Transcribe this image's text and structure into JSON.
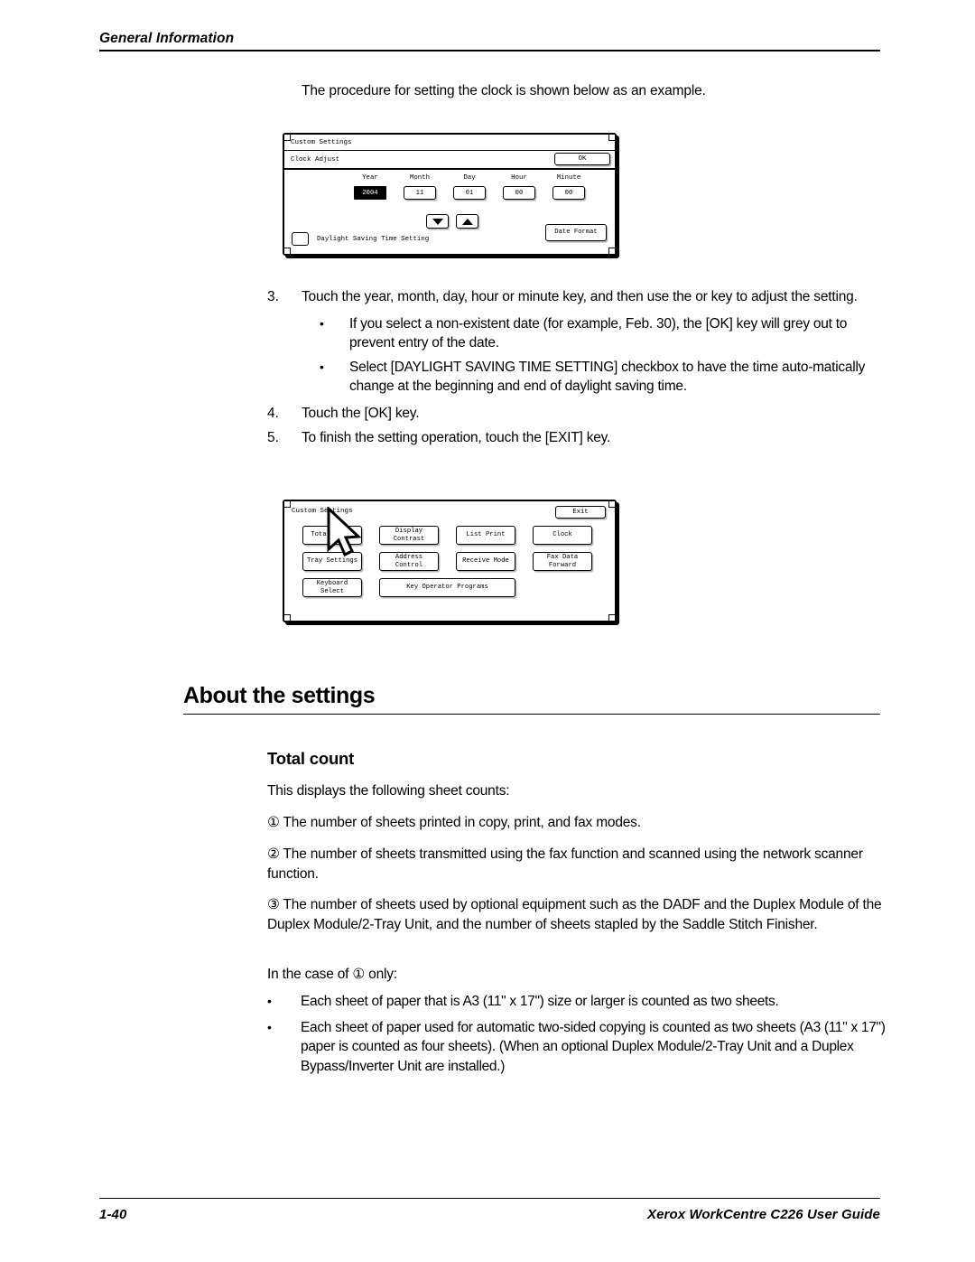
{
  "header": {
    "running_head": "General Information"
  },
  "intro": {
    "text": "The procedure for setting the clock is shown below as an example."
  },
  "clock_panel": {
    "title": "Custom Settings",
    "subtitle": "Clock Adjust",
    "ok_label": "OK",
    "fields": [
      {
        "label": "Year",
        "value": "2004",
        "selected": true
      },
      {
        "label": "Month",
        "value": "11",
        "selected": false
      },
      {
        "label": "Day",
        "value": "01",
        "selected": false
      },
      {
        "label": "Hour",
        "value": "00",
        "selected": false
      },
      {
        "label": "Minute",
        "value": "00",
        "selected": false
      }
    ],
    "down_arrow_icon": "triangle-down-icon",
    "up_arrow_icon": "triangle-up-icon",
    "checkbox_label": "Daylight Saving Time Setting",
    "checkbox_checked": false,
    "date_format_label": "Date Format"
  },
  "steps": [
    {
      "num": "3.",
      "text": "Touch the year, month, day, hour or minute key, and then use the  or  key to adjust the setting."
    },
    {
      "num": "4.",
      "text": "Touch the [OK] key."
    },
    {
      "num": "5.",
      "text": "To finish the setting operation, touch the [EXIT] key."
    }
  ],
  "step_sub_bullets": [
    {
      "bullet": "•",
      "text": "If you select a non-existent date (for example, Feb. 30), the [OK] key will grey out to prevent entry of the date."
    },
    {
      "bullet": "•",
      "text": "Select [DAYLIGHT SAVING TIME SETTING] checkbox to have the time auto-matically change at the beginning and end of daylight saving time."
    }
  ],
  "menu_panel": {
    "title": "Custom Settings",
    "exit_label": "Exit",
    "cursor_icon": "mouse-pointer-icon",
    "rows": [
      [
        {
          "label": "Total Count"
        },
        {
          "label": "Display\nContrast"
        },
        {
          "label": "List Print"
        },
        {
          "label": "Clock"
        }
      ],
      [
        {
          "label": "Tray Settings"
        },
        {
          "label": "Address\nControl"
        },
        {
          "label": "Receive Mode"
        },
        {
          "label": "Fax Data\nForward"
        }
      ],
      [
        {
          "label": "Keyboard\nSelect"
        },
        {
          "label": "Key Operator Programs",
          "wide": true
        }
      ]
    ]
  },
  "section": {
    "h1": "About the settings",
    "h2": "Total count",
    "p_displays": "This displays the following sheet counts:",
    "p_one": "① The number of sheets printed in copy, print, and fax modes.",
    "p_two": "② The number of sheets transmitted using the fax function and scanned using the network scanner function.",
    "p_three": "③ The number of sheets used by optional equipment such as the DADF and the Duplex Module of the Duplex Module/2-Tray Unit, and the number of sheets stapled by the Saddle Stitch Finisher.",
    "p_case": "In the case of ① only:"
  },
  "tail_bullets": [
    {
      "bullet": "•",
      "text": "Each sheet of paper that is A3 (11\" x 17\") size or larger is counted as two sheets."
    },
    {
      "bullet": "•",
      "text": "Each sheet of paper used for automatic two-sided copying is counted as two sheets (A3 (11\" x 17\") paper is counted as four sheets). (When an optional Duplex Module/2-Tray Unit and a Duplex Bypass/Inverter Unit are installed.)"
    }
  ],
  "footer": {
    "page_number": "1-40",
    "guide_title": "Xerox WorkCentre C226 User Guide"
  }
}
